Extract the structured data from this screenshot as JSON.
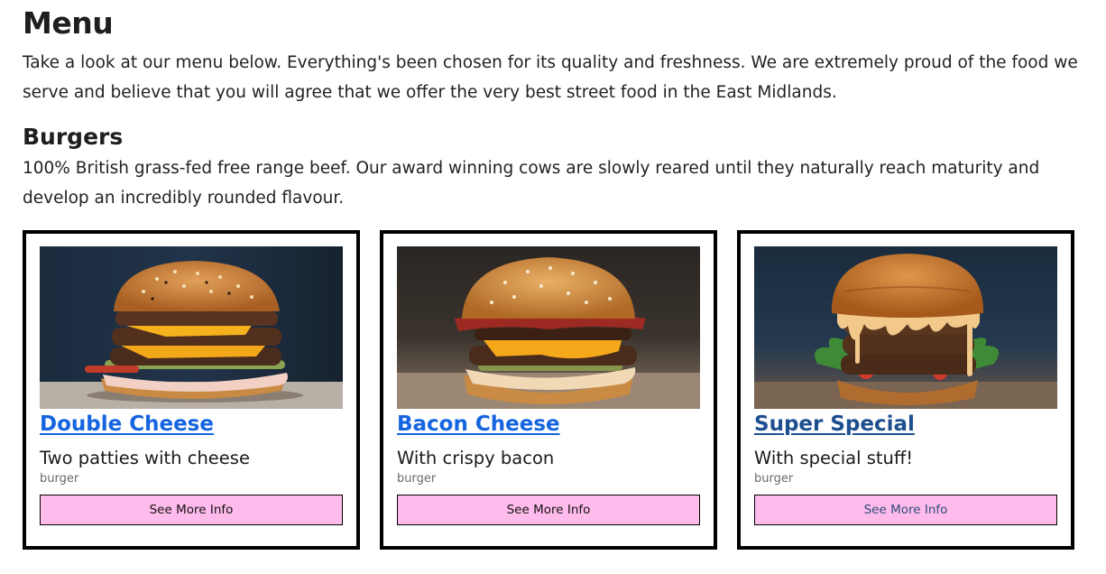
{
  "menu": {
    "title": "Menu",
    "intro": "Take a look at our menu below. Everything's been chosen for its quality and freshness. We are extremely proud of the food we serve and believe that you will agree that we offer the very best street food in the East Midlands."
  },
  "burgers": {
    "title": "Burgers",
    "description": "100% British grass-fed free range beef. Our award winning cows are slowly reared until they naturally reach maturity and develop an incredibly rounded flavour.",
    "items": [
      {
        "title": "Double Cheese",
        "description": "Two patties with cheese",
        "category": "burger",
        "button_label": "See More Info"
      },
      {
        "title": "Bacon Cheese",
        "description": "With crispy bacon",
        "category": "burger",
        "button_label": "See More Info"
      },
      {
        "title": "Super Special",
        "description": "With special stuff!",
        "category": "burger",
        "button_label": "See More Info"
      }
    ]
  },
  "colors": {
    "link": "#1565e0",
    "visited_link": "#1d4f8f",
    "button_bg": "#ffbbec",
    "card_border": "#000000"
  }
}
